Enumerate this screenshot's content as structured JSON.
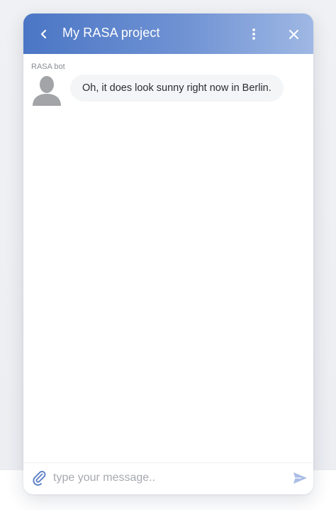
{
  "header": {
    "title": "My RASA project",
    "back_icon": "chevron-left-icon",
    "menu_icon": "more-vertical-icon",
    "close_icon": "close-icon",
    "gradient_colors": [
      "#4b76c5",
      "#9fb8e4"
    ]
  },
  "messages": [
    {
      "sender": "RASA bot",
      "avatar_icon": "user-silhouette-icon",
      "text": "Oh, it does look sunny right now in Berlin."
    }
  ],
  "composer": {
    "placeholder": "type your message..",
    "value": "",
    "attach_icon": "paperclip-icon",
    "send_icon": "send-icon",
    "icon_color": "#5b7fc7"
  }
}
